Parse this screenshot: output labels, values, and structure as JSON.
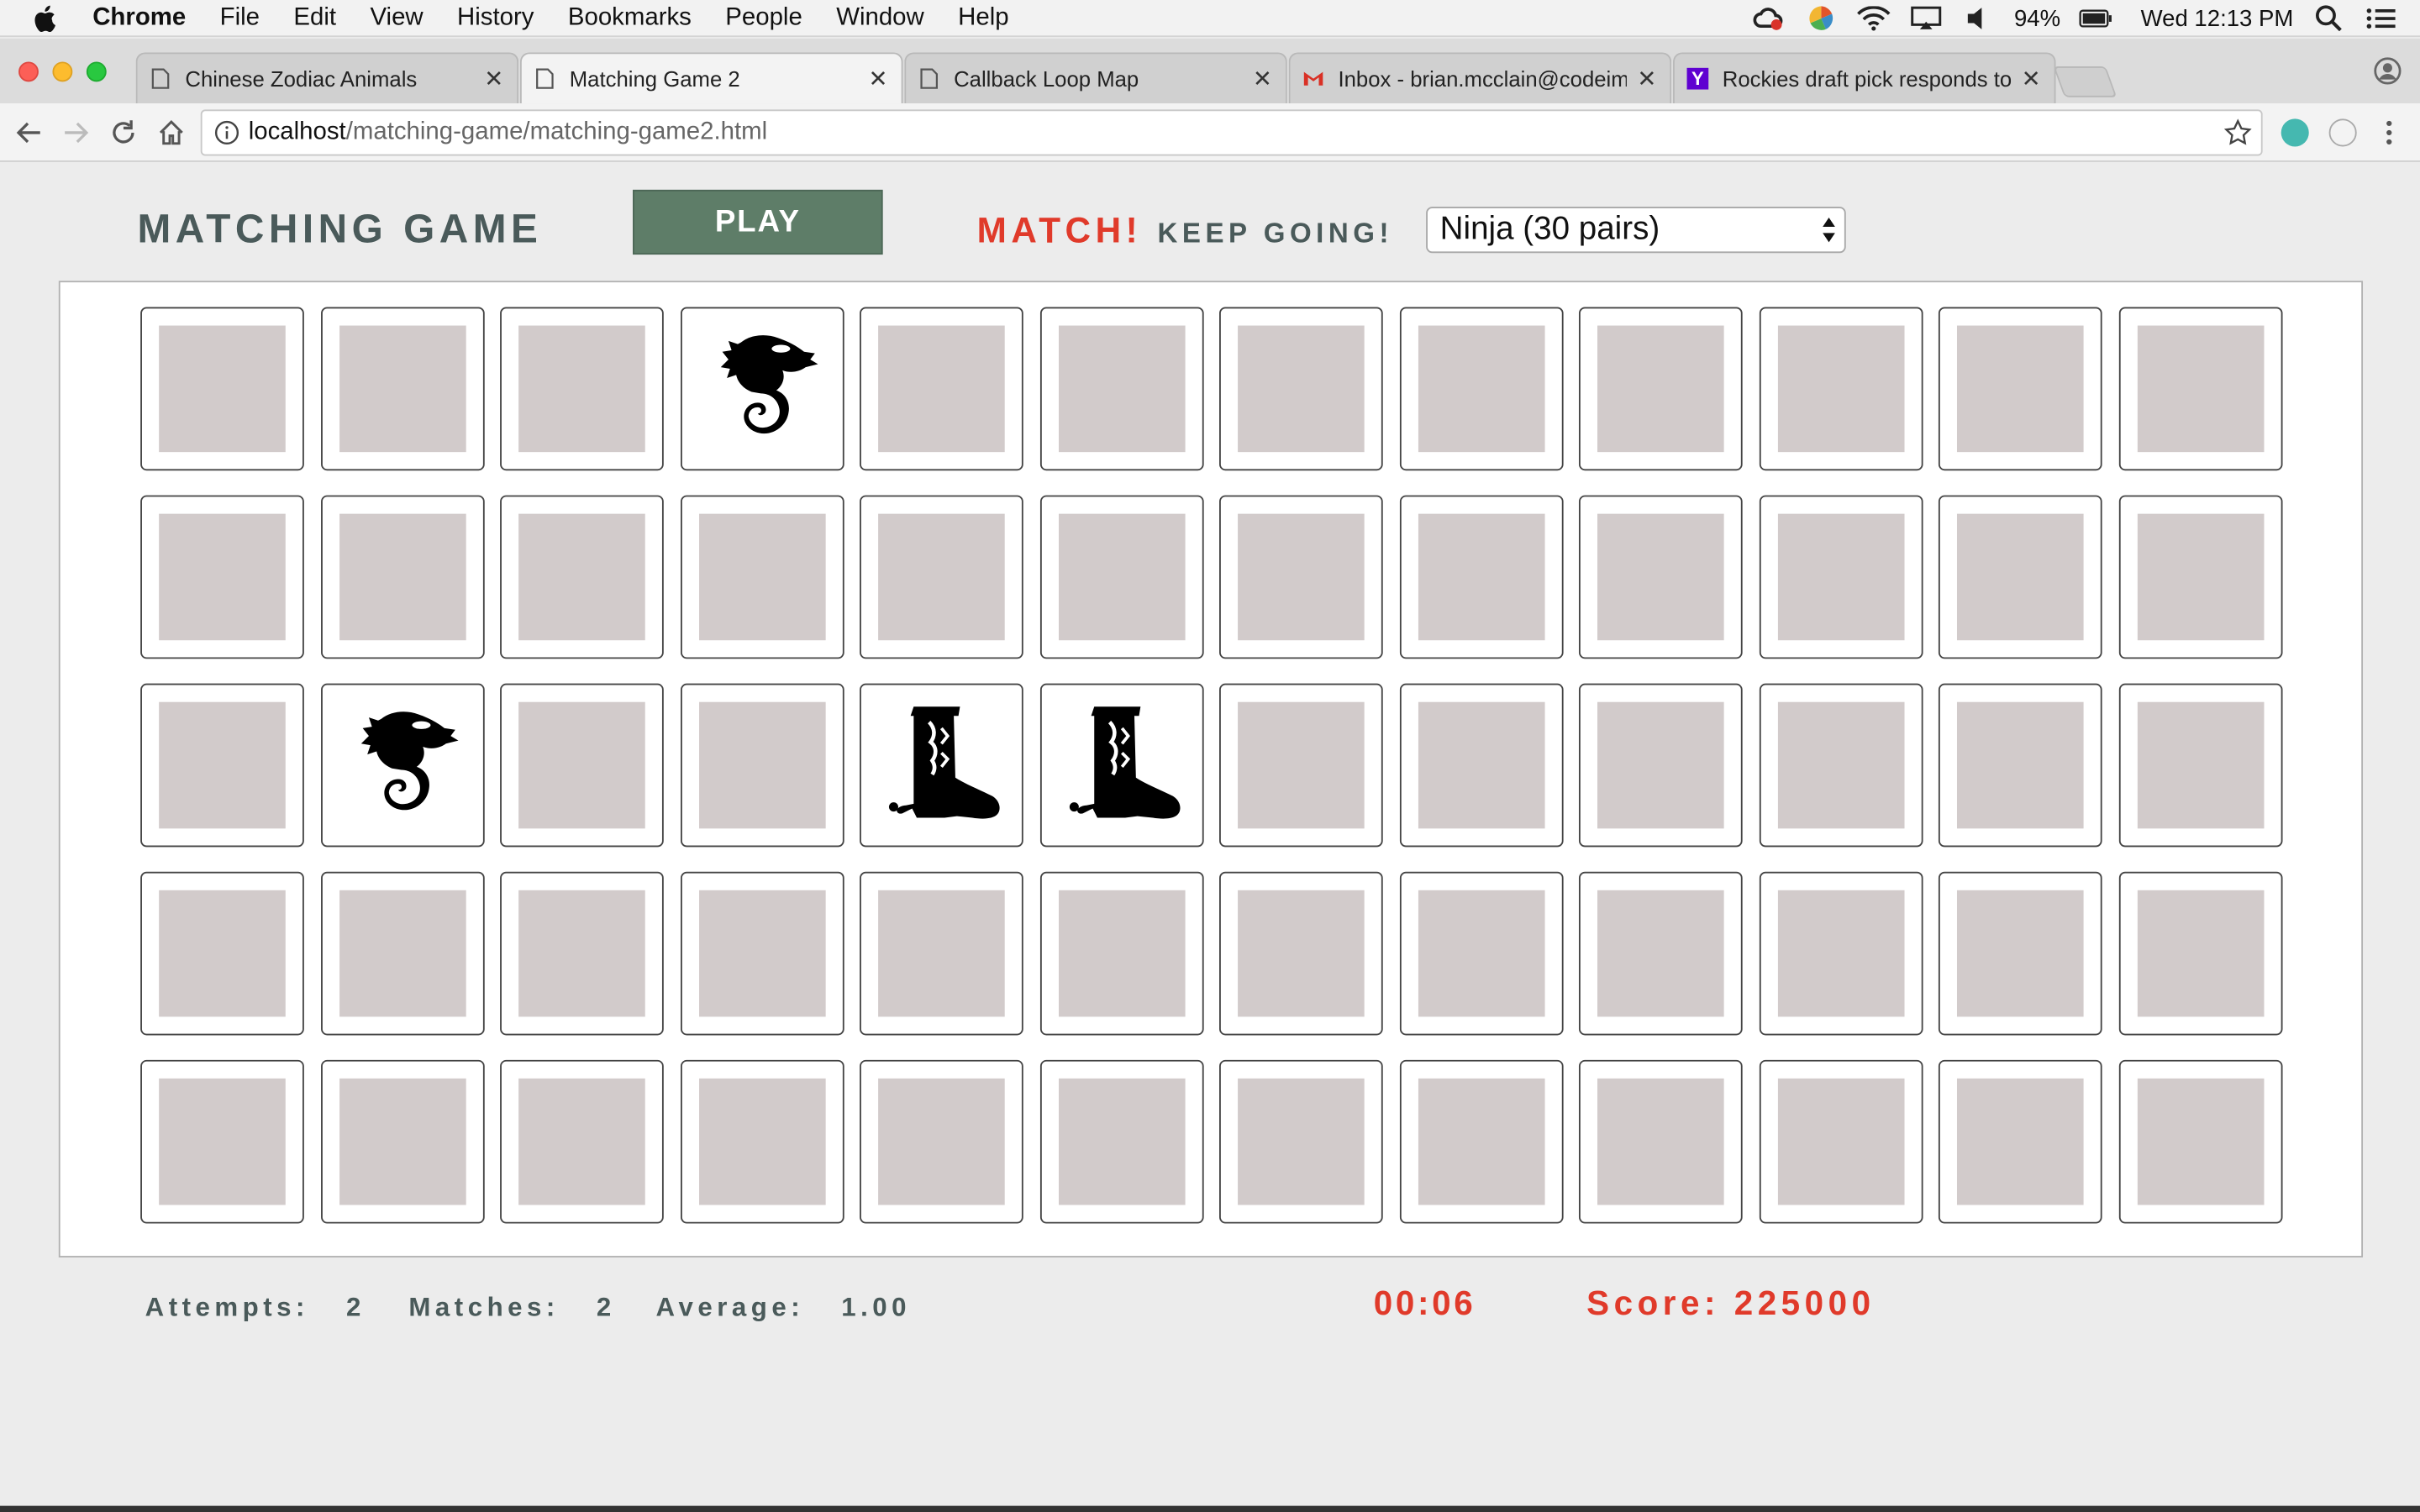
{
  "menubar": {
    "app": "Chrome",
    "items": [
      "File",
      "Edit",
      "View",
      "History",
      "Bookmarks",
      "People",
      "Window",
      "Help"
    ],
    "battery": "94%",
    "clock": "Wed 12:13 PM"
  },
  "tabs": [
    {
      "title": "Chinese Zodiac Animals",
      "icon": "page-icon"
    },
    {
      "title": "Matching Game 2",
      "icon": "page-icon",
      "active": true
    },
    {
      "title": "Callback Loop Map",
      "icon": "page-icon"
    },
    {
      "title": "Inbox - brian.mcclain@codeim",
      "icon": "gmail-icon"
    },
    {
      "title": "Rockies draft pick responds to",
      "icon": "yahoo-icon"
    }
  ],
  "address": {
    "host": "localhost",
    "path": "/matching-game/matching-game2.html"
  },
  "game": {
    "title": "MATCHING GAME",
    "play_label": "PLAY",
    "match_text": "MATCH!",
    "keep_text": "KEEP GOING!",
    "level": "Ninja (30 pairs)",
    "rows": 5,
    "cols": 12,
    "revealed": [
      {
        "row": 0,
        "col": 3,
        "image": "seahorse"
      },
      {
        "row": 2,
        "col": 1,
        "image": "seahorse"
      },
      {
        "row": 2,
        "col": 4,
        "image": "boot"
      },
      {
        "row": 2,
        "col": 5,
        "image": "boot"
      }
    ]
  },
  "stats": {
    "attempts_label": "Attempts:",
    "attempts": "2",
    "matches_label": "Matches:",
    "matches": "2",
    "average_label": "Average:",
    "average": "1.00",
    "timer": "00:06",
    "score": "Score: 225000"
  },
  "colors": {
    "accent_red": "#e03a2a",
    "play_green": "#5e7d68",
    "card_back": "#d2cbcb",
    "title_gray": "#4a5a5a"
  }
}
